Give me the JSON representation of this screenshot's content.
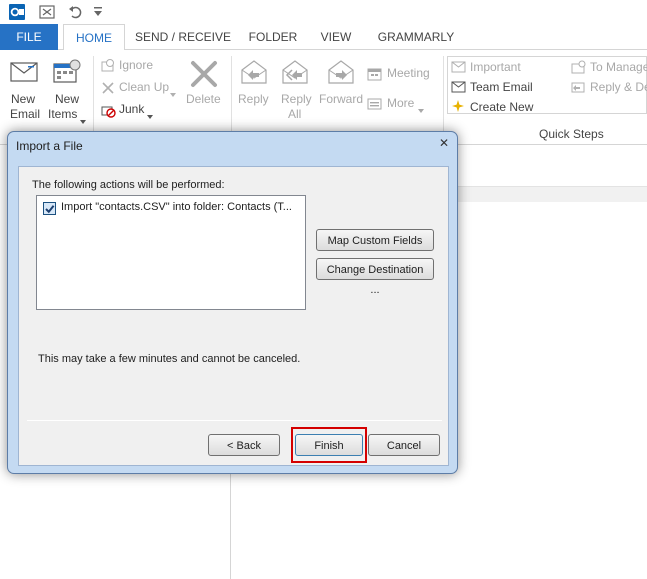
{
  "quick_access": {
    "icons": [
      "outlook-app-icon",
      "send-receive-icon",
      "undo-icon",
      "customize-qat-icon"
    ]
  },
  "tabs": {
    "file": "FILE",
    "home": "HOME",
    "send_receive": "SEND / RECEIVE",
    "folder": "FOLDER",
    "view": "VIEW",
    "grammarly": "GRAMMARLY"
  },
  "ribbon": {
    "new_email": [
      "New",
      "Email"
    ],
    "new_items": [
      "New",
      "Items"
    ],
    "ignore": "Ignore",
    "clean_up": "Clean Up",
    "junk": "Junk",
    "delete": "Delete",
    "reply": "Reply",
    "reply_all": [
      "Reply",
      "All"
    ],
    "forward": "Forward",
    "meeting": "Meeting",
    "more": "More",
    "quick_steps": {
      "important": "Important",
      "team_email": "Team Email",
      "create_new": "Create New",
      "to_manager": "To Manage",
      "reply_delete": "Reply & De",
      "group_label": "Quick Steps"
    }
  },
  "colors": {
    "accent": "#2672c5",
    "dialog_frame": "#c4daf2",
    "highlight": "#d40000"
  },
  "dialog": {
    "title": "Import a File",
    "close_glyph": "✕",
    "actions_label": "The following actions will be performed:",
    "action_item": "Import \"contacts.CSV\" into folder: Contacts (T...",
    "action_checked": true,
    "map_fields_button": "Map Custom Fields ...",
    "change_destination_button": "Change Destination ...",
    "warning": "This may take a few minutes and cannot be canceled.",
    "back_button": "< Back",
    "finish_button": "Finish",
    "cancel_button": "Cancel"
  }
}
